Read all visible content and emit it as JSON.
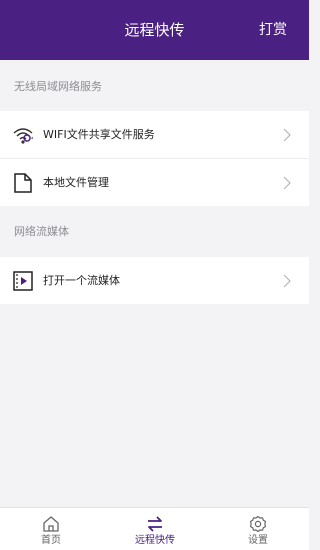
{
  "header": {
    "title": "远程快传",
    "action_label": "打赏"
  },
  "sections": [
    {
      "label": "无线局域网络服务",
      "items": [
        {
          "label": "WIFI文件共享文件服务",
          "icon": "wifi-share-icon"
        },
        {
          "label": "本地文件管理",
          "icon": "file-icon"
        }
      ]
    },
    {
      "label": "网络流媒体",
      "items": [
        {
          "label": "打开一个流媒体",
          "icon": "video-file-icon"
        }
      ]
    }
  ],
  "tabbar": {
    "tabs": [
      {
        "label": "首页",
        "icon": "home-icon",
        "active": false
      },
      {
        "label": "远程快传",
        "icon": "transfer-arrows-icon",
        "active": true
      },
      {
        "label": "设置",
        "icon": "gear-icon",
        "active": false
      }
    ]
  },
  "colors": {
    "accent": "#4a2182",
    "background": "#f3f3f6"
  }
}
